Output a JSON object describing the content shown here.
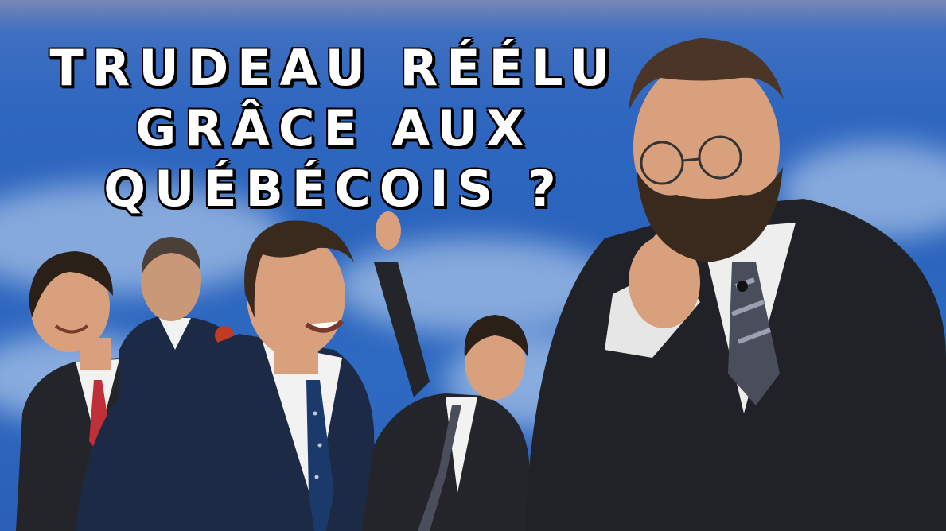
{
  "headline": {
    "line1": "TRUDEAU RÉÉLU",
    "line2": "GRÂCE AUX",
    "line3": "QUÉBÉCOIS ?"
  },
  "colors": {
    "sky": "#2f67c0",
    "title_text": "#ffffff",
    "title_outline": "#000000",
    "suit_dark": "#23252b",
    "suit_navy": "#1d2a45",
    "shirt_white": "#f2f2f2",
    "skin": "#d9a07e",
    "hair_brown": "#3a2a1e",
    "tie_navy_dots": "#1b3a6b",
    "tie_red": "#c0303a",
    "tie_striped": "#4a4e5c"
  }
}
